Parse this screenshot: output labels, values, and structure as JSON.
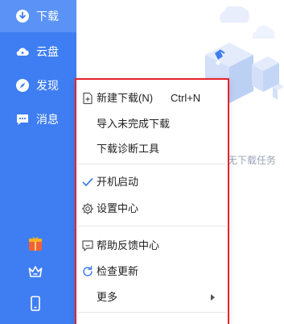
{
  "sidebar": {
    "items": [
      {
        "label": "下载",
        "icon": "download-icon"
      },
      {
        "label": "云盘",
        "icon": "cloud-icon"
      },
      {
        "label": "发现",
        "icon": "discover-compass-icon"
      },
      {
        "label": "消息",
        "icon": "message-icon"
      }
    ],
    "bottom_icons": [
      "gift-icon",
      "crown-icon",
      "mobile-icon"
    ]
  },
  "main": {
    "empty_text": "无下载任务"
  },
  "context_menu": {
    "new_download": {
      "label": "新建下载(N)",
      "shortcut": "Ctrl+N"
    },
    "import_incomplete": {
      "label": "导入未完成下载"
    },
    "diagnostics": {
      "label": "下载诊断工具"
    },
    "auto_start": {
      "label": "开机启动",
      "checked": true
    },
    "settings": {
      "label": "设置中心"
    },
    "help_feedback": {
      "label": "帮助反馈中心"
    },
    "check_update": {
      "label": "检查更新"
    },
    "more": {
      "label": "更多"
    }
  },
  "colors": {
    "sidebar_bg": "#3f7ef2",
    "active_item_bg": "#5a93f5",
    "highlight_border": "#e8232b",
    "accent": "#3f7ef2"
  }
}
